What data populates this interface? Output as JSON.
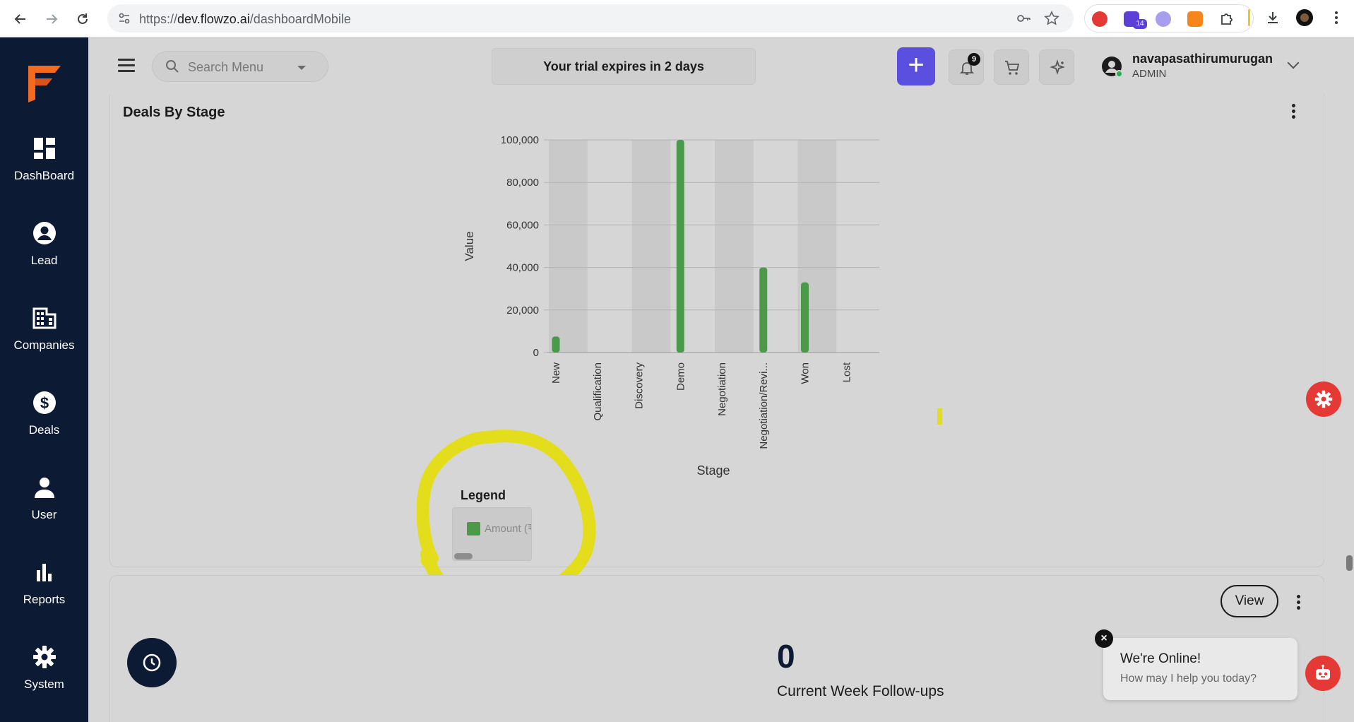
{
  "browser": {
    "url_prefix": "https://",
    "url_host": "dev.flowzo.ai",
    "url_path": "/dashboardMobile",
    "extension_badge": "14"
  },
  "sidebar": {
    "items": [
      {
        "label": "DashBoard",
        "icon": "dashboard-icon"
      },
      {
        "label": "Lead",
        "icon": "lead-icon"
      },
      {
        "label": "Companies",
        "icon": "companies-icon"
      },
      {
        "label": "Deals",
        "icon": "deals-icon"
      },
      {
        "label": "User",
        "icon": "user-icon"
      },
      {
        "label": "Reports",
        "icon": "reports-icon"
      },
      {
        "label": "System",
        "icon": "system-icon"
      }
    ]
  },
  "header": {
    "search_placeholder": "Search Menu",
    "trial_text": "Your trial expires in 2 days",
    "plus_label": "+",
    "notification_count": "9",
    "user_name": "navapasathirumurugan",
    "user_role": "ADMIN"
  },
  "deals_card": {
    "title": "Deals By Stage",
    "legend_title": "Legend",
    "legend_item": "Amount (₹)"
  },
  "chart_data": {
    "type": "bar",
    "title": "",
    "xlabel": "Stage",
    "ylabel": "Value",
    "ylim": [
      0,
      100000
    ],
    "yticks": [
      "0",
      "20,000",
      "40,000",
      "60,000",
      "80,000",
      "100,000"
    ],
    "categories": [
      "New",
      "Qualification",
      "Discovery",
      "Demo",
      "Negotiation",
      "Negotiation/Revi...",
      "Won",
      "Lost"
    ],
    "series": [
      {
        "name": "Amount (₹)",
        "values": [
          7500,
          0,
          0,
          100000,
          0,
          40000,
          33000,
          0
        ],
        "color": "#4a9a4a"
      }
    ],
    "band_color": "#c9c9c9"
  },
  "followups_card": {
    "view_label": "View",
    "count": "0",
    "count_label": "Current Week Follow-ups"
  },
  "chat": {
    "title": "We're Online!",
    "subtitle": "How may I help you today?",
    "close_label": "×"
  },
  "colors": {
    "sidebar_bg": "#0d1a33",
    "accent_purple": "#5b4fe0",
    "fab_red": "#e53935",
    "annotation_yellow": "#e4dd1c"
  }
}
